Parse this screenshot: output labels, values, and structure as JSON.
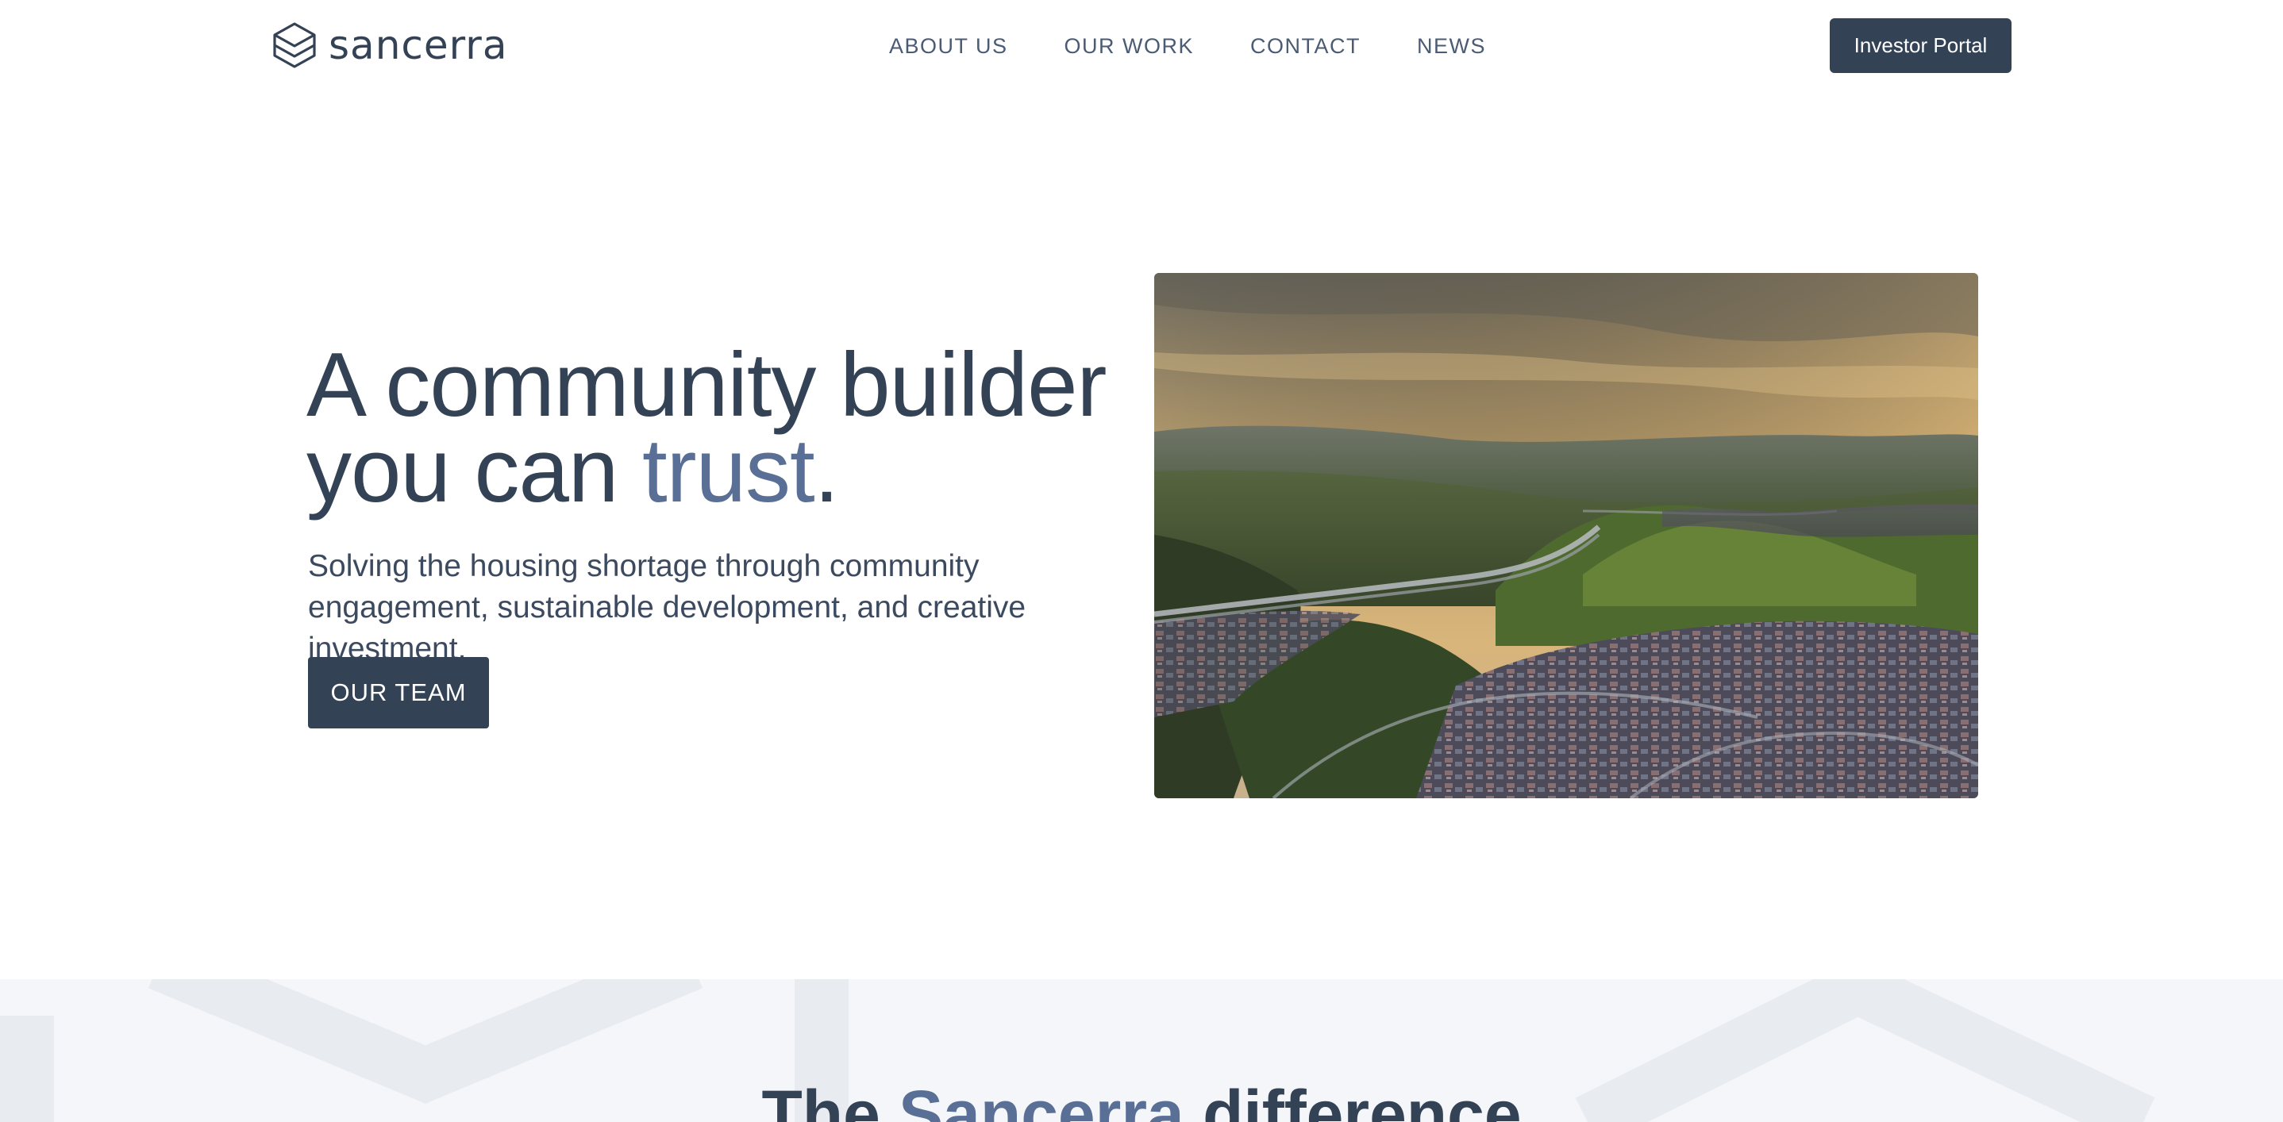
{
  "brand": {
    "name": "sancerra",
    "icon": "hexagon-logo-icon"
  },
  "nav": {
    "items": [
      {
        "label": "ABOUT US"
      },
      {
        "label": "OUR WORK"
      },
      {
        "label": "CONTACT"
      },
      {
        "label": "NEWS"
      }
    ],
    "portal_label": "Investor Portal"
  },
  "hero": {
    "title_line1": "A community builder",
    "title_line2_prefix": "you can ",
    "title_accent": "trust",
    "title_suffix": ".",
    "subtitle": "Solving the housing shortage through community engagement, sustainable development, and creative investment.",
    "cta_label": "OUR TEAM",
    "image": "aerial-suburban-valley-photo"
  },
  "difference": {
    "title_prefix": "The ",
    "title_accent": "Sancerra",
    "title_suffix": " difference"
  },
  "colors": {
    "primary": "#344256",
    "accent": "#5a6f95",
    "section_bg": "#f4f6f9"
  }
}
